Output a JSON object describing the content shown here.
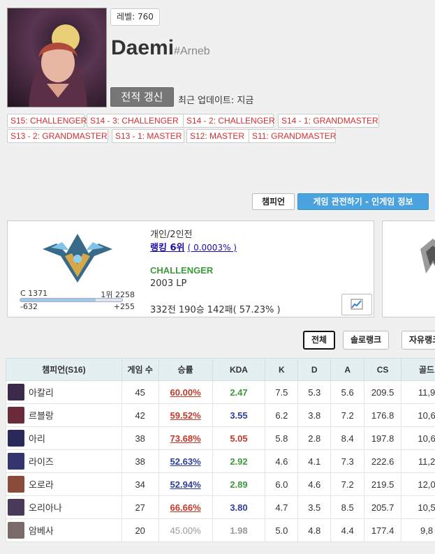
{
  "profile": {
    "level_label": "레벨: 760",
    "name": "Daemi",
    "tag": "#Arneb",
    "refresh_label": "전적 갱신",
    "last_update": "최근 업데이트: 지금"
  },
  "season_badges": [
    "S15: CHALLENGER",
    "S14 - 3: CHALLENGER",
    "S14 - 2: CHALLENGER",
    "S14 - 1: GRANDMASTER",
    "S13 - 2: GRANDMASTER",
    "S13 - 1: MASTER",
    "S12: MASTER",
    "S11: GRANDMASTER"
  ],
  "tabs": {
    "champion": "챔피언",
    "spectate": "게임 관전하기 - 인게임 정보"
  },
  "rank": {
    "queue": "개인/2인전",
    "ranking": "랭킹 6위",
    "ranking_pct": "( 0.0003% )",
    "tier": "CHALLENGER",
    "lp": "2003 LP",
    "record": "332전 190승 142패( 57.23% )",
    "bar_left": "C 1371",
    "bar_right": "1위 2258",
    "bar_left_sub": "-632",
    "bar_right_sub": "+255",
    "bar_progress": 0.74
  },
  "filters": [
    "전체",
    "솔로랭크",
    "자유랭크"
  ],
  "table": {
    "headers": [
      "챔피언(S16)",
      "게임 수",
      "승률",
      "KDA",
      "K",
      "D",
      "A",
      "CS",
      "골드"
    ],
    "rows": [
      {
        "champ": "아칼리",
        "games": "45",
        "wr": "60.00%",
        "kda": "2.47",
        "k": "7.5",
        "d": "5.3",
        "a": "5.6",
        "cs": "209.5",
        "gold": "11,9",
        "wr_color": "red",
        "kda_color": "green",
        "icon_color": "#3b2a4a"
      },
      {
        "champ": "르블랑",
        "games": "42",
        "wr": "59.52%",
        "kda": "3.55",
        "k": "6.2",
        "d": "3.8",
        "a": "7.2",
        "cs": "176.8",
        "gold": "10,6",
        "wr_color": "red",
        "kda_color": "blue",
        "icon_color": "#6a2b3a"
      },
      {
        "champ": "아리",
        "games": "38",
        "wr": "73.68%",
        "kda": "5.05",
        "k": "5.8",
        "d": "2.8",
        "a": "8.4",
        "cs": "197.8",
        "gold": "10,6",
        "wr_color": "red",
        "kda_color": "red",
        "icon_color": "#2a2a5a"
      },
      {
        "champ": "라이즈",
        "games": "38",
        "wr": "52.63%",
        "kda": "2.92",
        "k": "4.6",
        "d": "4.1",
        "a": "7.3",
        "cs": "222.6",
        "gold": "11,2",
        "wr_color": "blue",
        "kda_color": "green",
        "icon_color": "#35346e"
      },
      {
        "champ": "오로라",
        "games": "34",
        "wr": "52.94%",
        "kda": "2.89",
        "k": "6.0",
        "d": "4.6",
        "a": "7.2",
        "cs": "219.5",
        "gold": "12,0",
        "wr_color": "blue",
        "kda_color": "green",
        "icon_color": "#8a4b3a"
      },
      {
        "champ": "오리아나",
        "games": "27",
        "wr": "66.66%",
        "kda": "3.80",
        "k": "4.7",
        "d": "3.5",
        "a": "8.5",
        "cs": "205.7",
        "gold": "10,5",
        "wr_color": "red",
        "kda_color": "blue",
        "icon_color": "#4a3a5a"
      },
      {
        "champ": "암베사",
        "games": "20",
        "wr": "45.00%",
        "kda": "1.98",
        "k": "5.0",
        "d": "4.8",
        "a": "4.4",
        "cs": "177.4",
        "gold": "9,8",
        "wr_color": "gray",
        "kda_color": "gray",
        "icon_color": "#7a6a6a"
      }
    ]
  }
}
